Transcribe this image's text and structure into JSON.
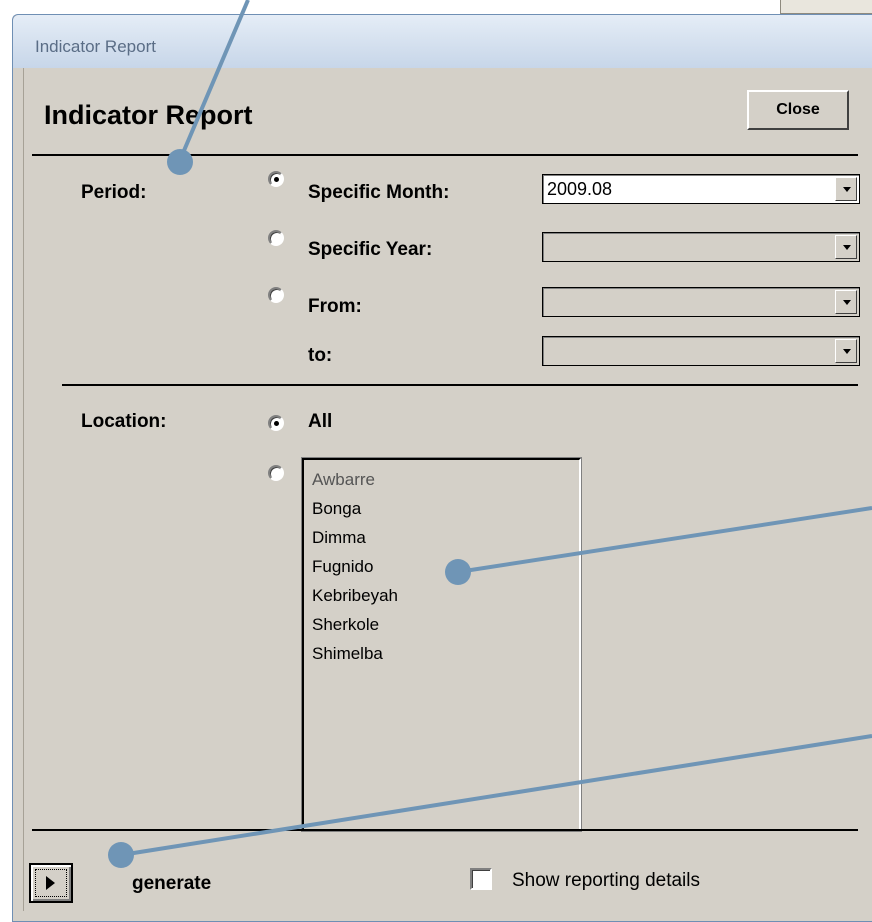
{
  "window": {
    "title": "Indicator Report"
  },
  "form": {
    "heading": "Indicator Report",
    "close_label": "Close"
  },
  "period": {
    "label": "Period:",
    "options": [
      {
        "label": "Specific Month:",
        "selected": true,
        "value": "2009.08"
      },
      {
        "label": "Specific Year:",
        "selected": false,
        "value": ""
      },
      {
        "label": "From:",
        "selected": false,
        "value": ""
      }
    ],
    "to_label": "to:",
    "to_value": ""
  },
  "location": {
    "label": "Location:",
    "all_label": "All",
    "all_selected": true,
    "list_selected": false,
    "items": [
      "Awbarre",
      "Bonga",
      "Dimma",
      "Fugnido",
      "Kebribeyah",
      "Sherkole",
      "Shimelba"
    ]
  },
  "footer": {
    "generate_label": "generate",
    "show_details_label": "Show reporting details",
    "show_details_checked": false
  },
  "colors": {
    "form_background": "#d4d0c8",
    "title_bar": "#d3dfee",
    "callout": "#6f95b6"
  },
  "icons": {
    "generate": "play-triangle-icon",
    "dropdown": "chevron-down-icon"
  }
}
